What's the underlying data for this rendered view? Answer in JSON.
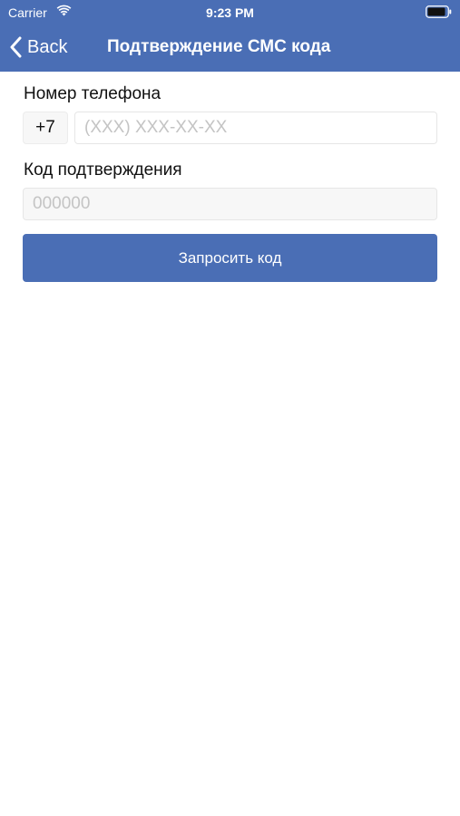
{
  "status_bar": {
    "carrier": "Carrier",
    "time": "9:23 PM",
    "wifi_icon": "wifi-icon",
    "battery_icon": "battery-icon"
  },
  "nav": {
    "back_label": "Back",
    "back_icon": "chevron-left-icon",
    "title": "Подтверждение СМС кода"
  },
  "form": {
    "phone_label": "Номер телефона",
    "phone_prefix": "+7",
    "phone_value": "",
    "phone_placeholder": "(XXX) XXX-XX-XX",
    "code_label": "Код подтверждения",
    "code_value": "",
    "code_placeholder": "000000",
    "request_button_label": "Запросить код"
  },
  "colors": {
    "accent": "#4a6eb5",
    "background": "#ffffff",
    "input_disabled_bg": "#f7f7f7",
    "placeholder": "#c4c4c4"
  }
}
